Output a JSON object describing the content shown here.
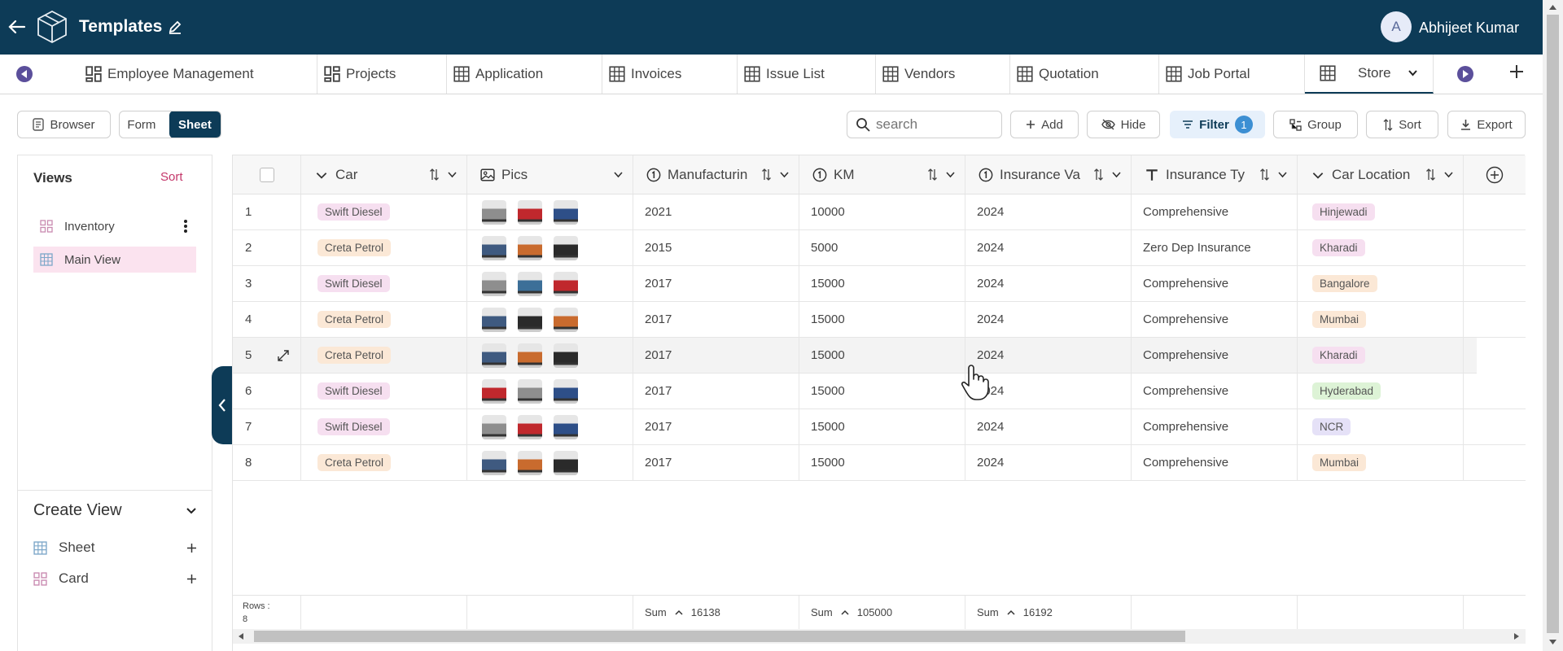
{
  "app": {
    "title": "Templates",
    "user_initial": "A",
    "user_name": "Abhijeet Kumar"
  },
  "tabs": [
    {
      "label": "Employee Management",
      "icon": "dashboard-icon"
    },
    {
      "label": "Projects",
      "icon": "dashboard-icon"
    },
    {
      "label": "Application",
      "icon": "table-icon"
    },
    {
      "label": "Invoices",
      "icon": "table-icon"
    },
    {
      "label": "Issue List",
      "icon": "table-icon"
    },
    {
      "label": "Vendors",
      "icon": "table-icon"
    },
    {
      "label": "Quotation",
      "icon": "table-icon"
    },
    {
      "label": "Job Portal",
      "icon": "table-icon"
    },
    {
      "label": "Store",
      "icon": "table-icon",
      "active": true
    }
  ],
  "toolbar": {
    "browser": "Browser",
    "form": "Form",
    "sheet": "Sheet",
    "search_placeholder": "search",
    "add": "Add",
    "hide": "Hide",
    "filter": "Filter",
    "filter_count": "1",
    "group": "Group",
    "sort": "Sort",
    "export": "Export"
  },
  "views": {
    "title": "Views",
    "sort": "Sort",
    "items": [
      {
        "label": "Inventory",
        "icon": "card-icon"
      },
      {
        "label": "Main View",
        "icon": "table-icon",
        "selected": true
      }
    ],
    "create_title": "Create View",
    "create_items": [
      {
        "label": "Sheet",
        "icon": "table-icon"
      },
      {
        "label": "Card",
        "icon": "card-icon"
      }
    ]
  },
  "grid": {
    "columns": [
      {
        "label": "Car",
        "icon": "chevron-down-icon"
      },
      {
        "label": "Pics",
        "icon": "image-icon"
      },
      {
        "label": "Manufacturin",
        "icon": "number-icon"
      },
      {
        "label": "KM",
        "icon": "number-icon"
      },
      {
        "label": "Insurance Va",
        "icon": "number-icon"
      },
      {
        "label": "Insurance Ty",
        "icon": "text-icon"
      },
      {
        "label": "Car Location",
        "icon": "chevron-down-icon"
      }
    ],
    "rows": [
      {
        "n": "1",
        "car": "Swift Diesel",
        "pics": [
          "#8e8e8e",
          "#c0282d",
          "#2e4f88"
        ],
        "year": "2021",
        "km": "10000",
        "ins": "2024",
        "type": "Comprehensive",
        "loc": "Hinjewadi",
        "loc_color": "#f6dff0"
      },
      {
        "n": "2",
        "car": "Creta Petrol",
        "pics": [
          "#3f5a80",
          "#c96b2e",
          "#2a2a2a"
        ],
        "year": "2015",
        "km": "5000",
        "ins": "2024",
        "type": "Zero Dep Insurance",
        "loc": "Kharadi",
        "loc_color": "#f6dff0"
      },
      {
        "n": "3",
        "car": "Swift Diesel",
        "pics": [
          "#8e8e8e",
          "#3c6f98",
          "#c0282d"
        ],
        "year": "2017",
        "km": "15000",
        "ins": "2024",
        "type": "Comprehensive",
        "loc": "Bangalore",
        "loc_color": "#fbe8d6"
      },
      {
        "n": "4",
        "car": "Creta Petrol",
        "pics": [
          "#3f5a80",
          "#2a2a2a",
          "#c96b2e"
        ],
        "year": "2017",
        "km": "15000",
        "ins": "2024",
        "type": "Comprehensive",
        "loc": "Mumbai",
        "loc_color": "#fbe8d6"
      },
      {
        "n": "5",
        "car": "Creta Petrol",
        "pics": [
          "#3f5a80",
          "#c96b2e",
          "#2a2a2a"
        ],
        "year": "2017",
        "km": "15000",
        "ins": "2024",
        "type": "Comprehensive",
        "loc": "Kharadi",
        "loc_color": "#f6dff0",
        "hover": true
      },
      {
        "n": "6",
        "car": "Swift Diesel",
        "pics": [
          "#c0282d",
          "#8e8e8e",
          "#2e4f88"
        ],
        "year": "2017",
        "km": "15000",
        "ins": "2024",
        "type": "Comprehensive",
        "loc": "Hyderabad",
        "loc_color": "#ddf3d6"
      },
      {
        "n": "7",
        "car": "Swift Diesel",
        "pics": [
          "#8e8e8e",
          "#c0282d",
          "#2e4f88"
        ],
        "year": "2017",
        "km": "15000",
        "ins": "2024",
        "type": "Comprehensive",
        "loc": "NCR",
        "loc_color": "#e5e1f7"
      },
      {
        "n": "8",
        "car": "Creta Petrol",
        "pics": [
          "#3f5a80",
          "#c96b2e",
          "#2a2a2a"
        ],
        "year": "2017",
        "km": "15000",
        "ins": "2024",
        "type": "Comprehensive",
        "loc": "Mumbai",
        "loc_color": "#fbe8d6"
      }
    ],
    "car_colors": {
      "Swift Diesel": "#f6dff0",
      "Creta Petrol": "#fbe8d6"
    },
    "footer": {
      "rows_label": "Rows :",
      "rows_count": "8",
      "sum_label": "Sum",
      "sum_year": "16138",
      "sum_km": "105000",
      "sum_ins": "16192"
    }
  },
  "colors": {
    "header_bg": "#0d3b57",
    "accent": "#0d3b57",
    "tab_nav": "#5b4f9b",
    "selected_view": "#fbe3ef",
    "filter_bg": "#e6f0fb"
  }
}
